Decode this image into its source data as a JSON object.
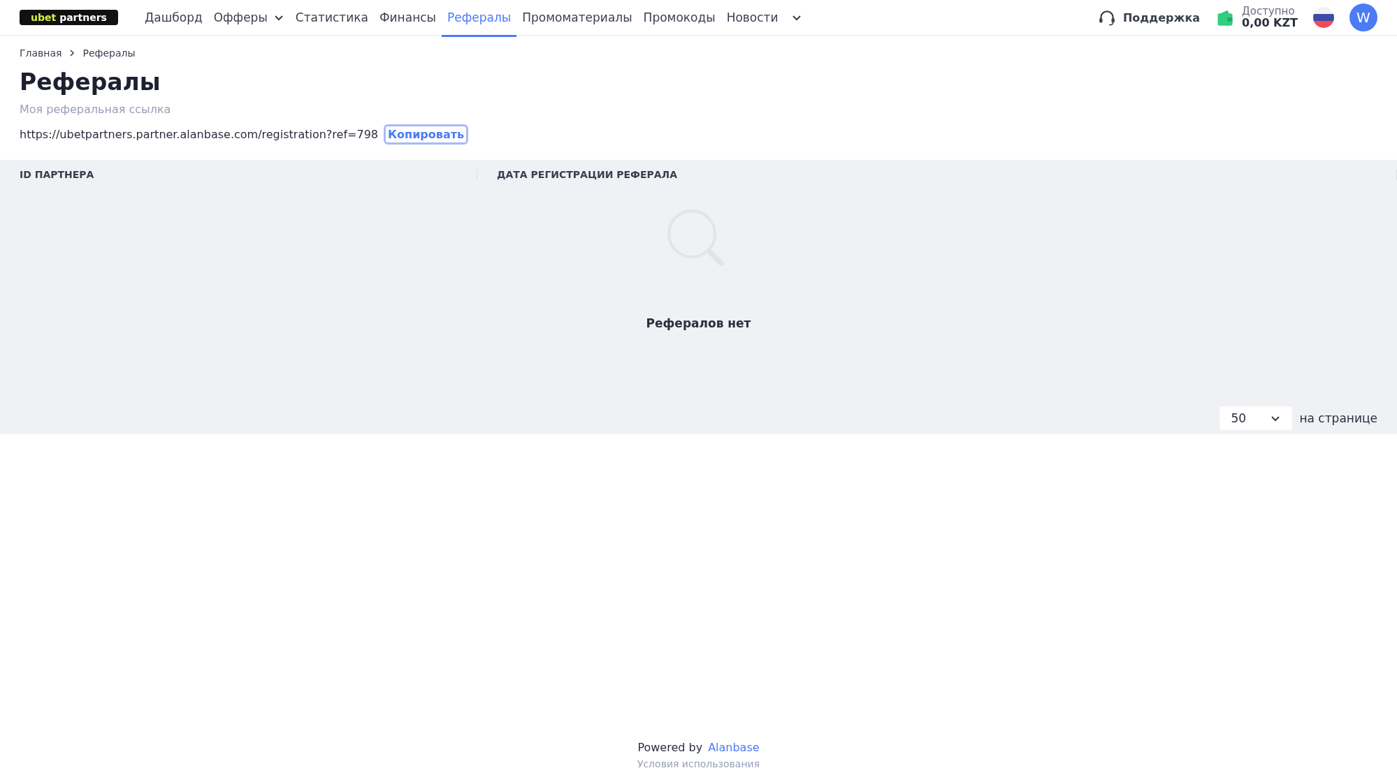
{
  "logo": {
    "accent": "ubet",
    "text": "partners"
  },
  "nav": [
    {
      "label": "Дашборд",
      "selected": false,
      "dropdown": false
    },
    {
      "label": "Офферы",
      "selected": false,
      "dropdown": true
    },
    {
      "label": "Статистика",
      "selected": false,
      "dropdown": false
    },
    {
      "label": "Финансы",
      "selected": false,
      "dropdown": false
    },
    {
      "label": "Рефералы",
      "selected": true,
      "dropdown": false
    },
    {
      "label": "Промоматериалы",
      "selected": false,
      "dropdown": false
    },
    {
      "label": "Промокоды",
      "selected": false,
      "dropdown": false
    },
    {
      "label": "Новости",
      "selected": false,
      "dropdown": false
    }
  ],
  "support": "Поддержка",
  "balance": {
    "label": "Доступно",
    "amount": "0,00 KZT"
  },
  "avatar": "W",
  "breadcrumb": [
    "Главная",
    "Рефералы"
  ],
  "title": "Рефералы",
  "ref_label": "Моя реферальная ссылка",
  "ref_link": "https://ubetpartners.partner.alanbase.com/registration?ref=798",
  "copy_button": "Копировать",
  "table": {
    "columns": [
      "ID ПАРТНЕРА",
      "ДАТА РЕГИСТРАЦИИ РЕФЕРАЛА"
    ],
    "empty": "Рефералов нет"
  },
  "pagination": {
    "per_page": "50",
    "label": "на странице"
  },
  "footer": {
    "powered": "Powered by",
    "brand": "Alanbase",
    "terms": "Условия использования"
  }
}
